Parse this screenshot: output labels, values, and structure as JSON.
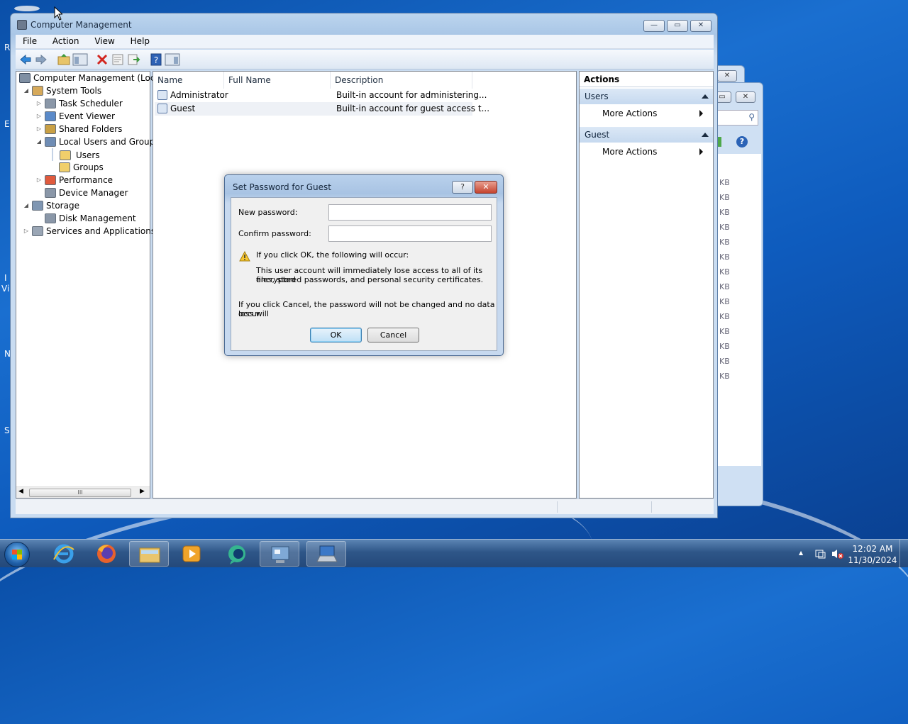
{
  "desktop": {
    "edge_letters": [
      "R",
      "E",
      "I",
      "Vi",
      "N",
      "S"
    ]
  },
  "window": {
    "title": "Computer Management",
    "menu": [
      "File",
      "Action",
      "View",
      "Help"
    ],
    "controls": {
      "minimize": "—",
      "maximize": "▭",
      "close": "✕"
    }
  },
  "tree": {
    "root": "Computer Management (Local",
    "items": [
      {
        "label": "System Tools",
        "level": 1,
        "expander": "◢"
      },
      {
        "label": "Task Scheduler",
        "level": 2,
        "expander": "▷"
      },
      {
        "label": "Event Viewer",
        "level": 2,
        "expander": "▷"
      },
      {
        "label": "Shared Folders",
        "level": 2,
        "expander": "▷"
      },
      {
        "label": "Local Users and Groups",
        "level": 2,
        "expander": "◢"
      },
      {
        "label": "Users",
        "level": 3,
        "expander": ""
      },
      {
        "label": "Groups",
        "level": 3,
        "expander": ""
      },
      {
        "label": "Performance",
        "level": 2,
        "expander": "▷"
      },
      {
        "label": "Device Manager",
        "level": 2,
        "expander": ""
      },
      {
        "label": "Storage",
        "level": 1,
        "expander": "◢"
      },
      {
        "label": "Disk Management",
        "level": 2,
        "expander": ""
      },
      {
        "label": "Services and Applications",
        "level": 1,
        "expander": "▷"
      }
    ],
    "scroll_grip": "III"
  },
  "users_list": {
    "columns": [
      "Name",
      "Full Name",
      "Description"
    ],
    "rows": [
      {
        "name": "Administrator",
        "full_name": "",
        "description": "Built-in account for administering..."
      },
      {
        "name": "Guest",
        "full_name": "",
        "description": "Built-in account for guest access t..."
      }
    ]
  },
  "actions": {
    "title": "Actions",
    "sections": [
      {
        "header": "Users",
        "item": "More Actions"
      },
      {
        "header": "Guest",
        "item": "More Actions"
      }
    ]
  },
  "dialog": {
    "title": "Set Password for Guest",
    "help_label": "?",
    "close_label": "✕",
    "new_password_label": "New password:",
    "new_password_value": "",
    "confirm_password_label": "Confirm password:",
    "confirm_password_value": "",
    "warning_heading": "If you click OK, the following will occur:",
    "warning_detail_1": "This user account will immediately lose access to all of its encrypted",
    "warning_detail_2": "files, stored passwords, and personal security certificates.",
    "cancel_note_1": "If you click Cancel, the password will not be changed and no data loss will",
    "cancel_note_2": "occur.",
    "ok_label": "OK",
    "cancel_label": "Cancel"
  },
  "background_window": {
    "close_label": "✕",
    "size_unit": "KB",
    "size_rows": 14
  },
  "taskbar": {
    "clock_time": "12:02 AM",
    "clock_date": "11/30/2024",
    "tray_up_arrow": "▲",
    "colors": {
      "accent": "#2e5688"
    }
  }
}
